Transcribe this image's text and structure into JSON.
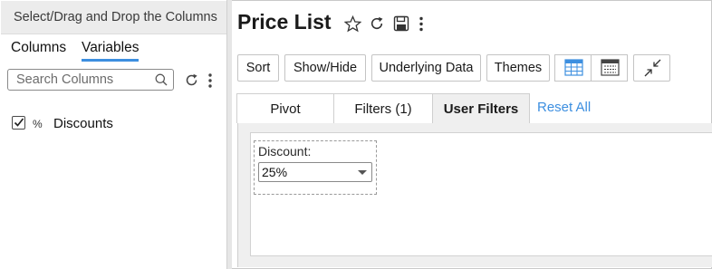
{
  "left_panel": {
    "header": "Select/Drag and Drop the Columns",
    "tabs": [
      {
        "label": "Columns",
        "active": false
      },
      {
        "label": "Variables",
        "active": true
      }
    ],
    "search": {
      "placeholder": "Search Columns"
    },
    "variables": [
      {
        "checked": true,
        "type_symbol": "%",
        "name": "Discounts"
      }
    ]
  },
  "main": {
    "title": "Price List",
    "title_icons": [
      "star-icon",
      "refresh-icon",
      "save-icon",
      "more-vertical-icon"
    ],
    "toolbar": {
      "sort": "Sort",
      "show_hide": "Show/Hide",
      "underlying_data": "Underlying Data",
      "themes": "Themes",
      "icon_buttons": [
        "table-layout-icon",
        "compact-table-icon",
        "collapse-icon"
      ]
    },
    "tabs": [
      {
        "label": "Pivot",
        "active": false
      },
      {
        "label": "Filters (1)",
        "active": false
      },
      {
        "label": "User Filters",
        "active": true
      }
    ],
    "reset_all": "Reset All",
    "user_filter": {
      "label": "Discount:",
      "selected": "25%"
    }
  },
  "colors": {
    "accent": "#3d8fe0",
    "active_tab_bg": "#efefef",
    "header_bg": "#ececec"
  }
}
